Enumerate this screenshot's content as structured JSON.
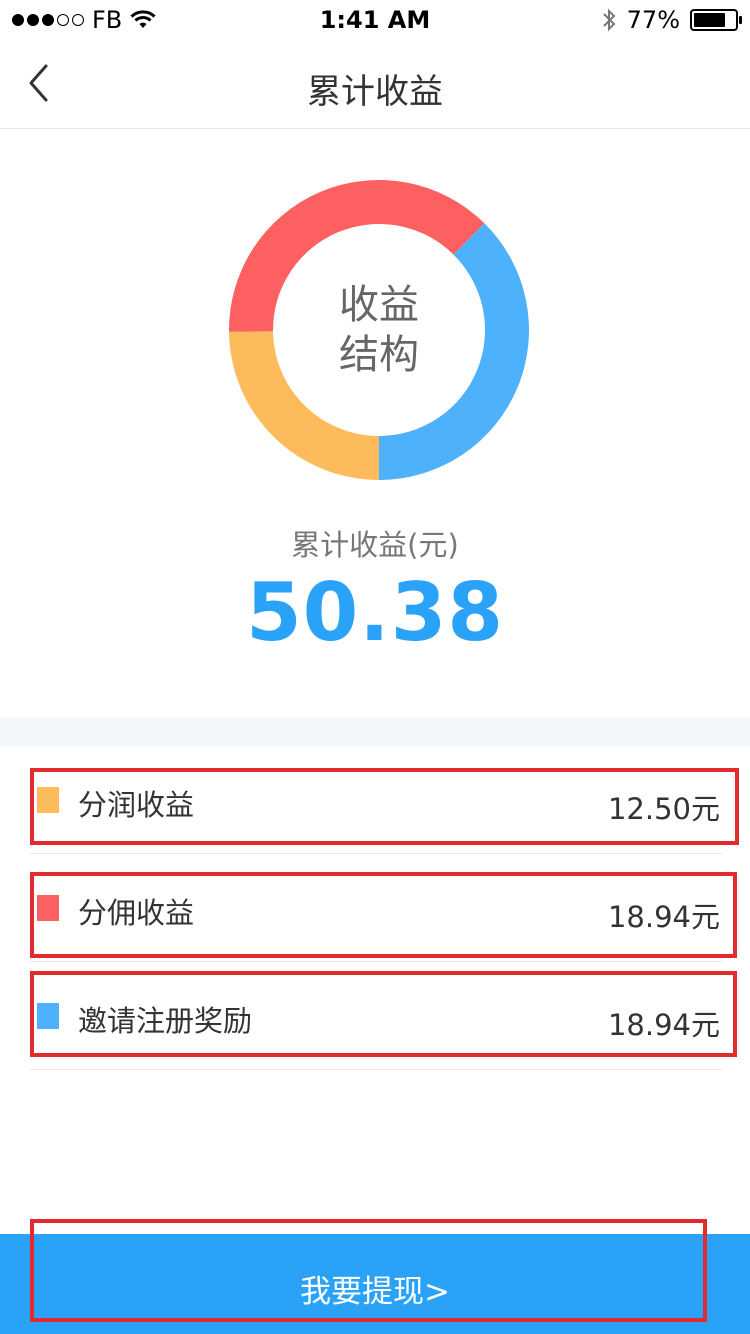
{
  "status_bar": {
    "carrier": "FB",
    "time": "1:41 AM",
    "battery": "77%",
    "battery_level": 0.77,
    "signal_bars_filled": 3,
    "signal_bars_total": 5,
    "icons": [
      "wifi-icon",
      "bluetooth-icon",
      "battery-icon"
    ]
  },
  "nav": {
    "title": "累计收益",
    "back_icon": "chevron-left-icon"
  },
  "donut": {
    "center_line1": "收益",
    "center_line2": "结构",
    "segments": [
      {
        "name": "分润收益",
        "value": 12.5,
        "color": "#fdbb5b"
      },
      {
        "name": "分佣收益",
        "value": 18.94,
        "color": "#fd6061"
      },
      {
        "name": "邀请注册奖励",
        "value": 18.94,
        "color": "#4eb1fb"
      }
    ]
  },
  "total": {
    "label": "累计收益(元)",
    "value": "50.38",
    "color": "#2aa2f7"
  },
  "income_items": [
    {
      "label": "分润收益",
      "amount": "12.50元",
      "color": "#fdbb5b"
    },
    {
      "label": "分佣收益",
      "amount": "18.94元",
      "color": "#fd6061"
    },
    {
      "label": "邀请注册奖励",
      "amount": "18.94元",
      "color": "#4eb1fb"
    }
  ],
  "withdraw": {
    "label": "我要提现>",
    "color": "#2aa2f7"
  },
  "highlight_color": "#e12b2e"
}
